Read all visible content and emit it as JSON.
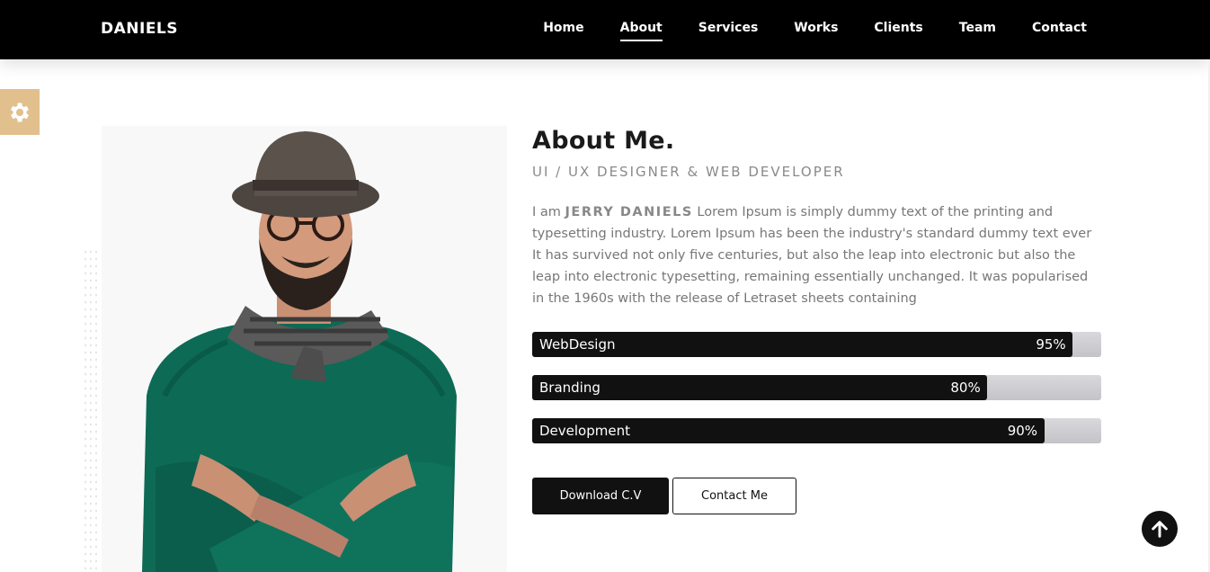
{
  "header": {
    "brand": "DANIELS",
    "nav": [
      {
        "label": "Home",
        "active": false
      },
      {
        "label": "About",
        "active": true
      },
      {
        "label": "Services",
        "active": false
      },
      {
        "label": "Works",
        "active": false
      },
      {
        "label": "Clients",
        "active": false
      },
      {
        "label": "Team",
        "active": false
      },
      {
        "label": "Contact",
        "active": false
      }
    ]
  },
  "settings": {
    "icon": "gear-icon",
    "color": "#e1c08e"
  },
  "about": {
    "title": "About Me.",
    "subtitle": "UI / UX DESIGNER & WEB DEVELOPER",
    "bio_prefix": "I am ",
    "bio_name": "JERRY DANIELS",
    "bio_text": " Lorem Ipsum is simply dummy text of the printing and typesetting industry. Lorem Ipsum has been the industry's standard dummy text ever It has survived not only five centuries, but also the leap into electronic but also the leap into electronic typesetting, remaining essentially unchanged. It was popularised in the 1960s with the release of Letraset sheets containing",
    "skills": [
      {
        "name": "WebDesign",
        "percent_label": "95%",
        "value": 0.95
      },
      {
        "name": "Branding",
        "percent_label": "80%",
        "value": 0.8
      },
      {
        "name": "Development",
        "percent_label": "90%",
        "value": 0.9
      }
    ],
    "download_button": "Download C.V",
    "contact_button": "Contact Me"
  },
  "scroll_top": {
    "icon": "arrow-up-icon"
  }
}
